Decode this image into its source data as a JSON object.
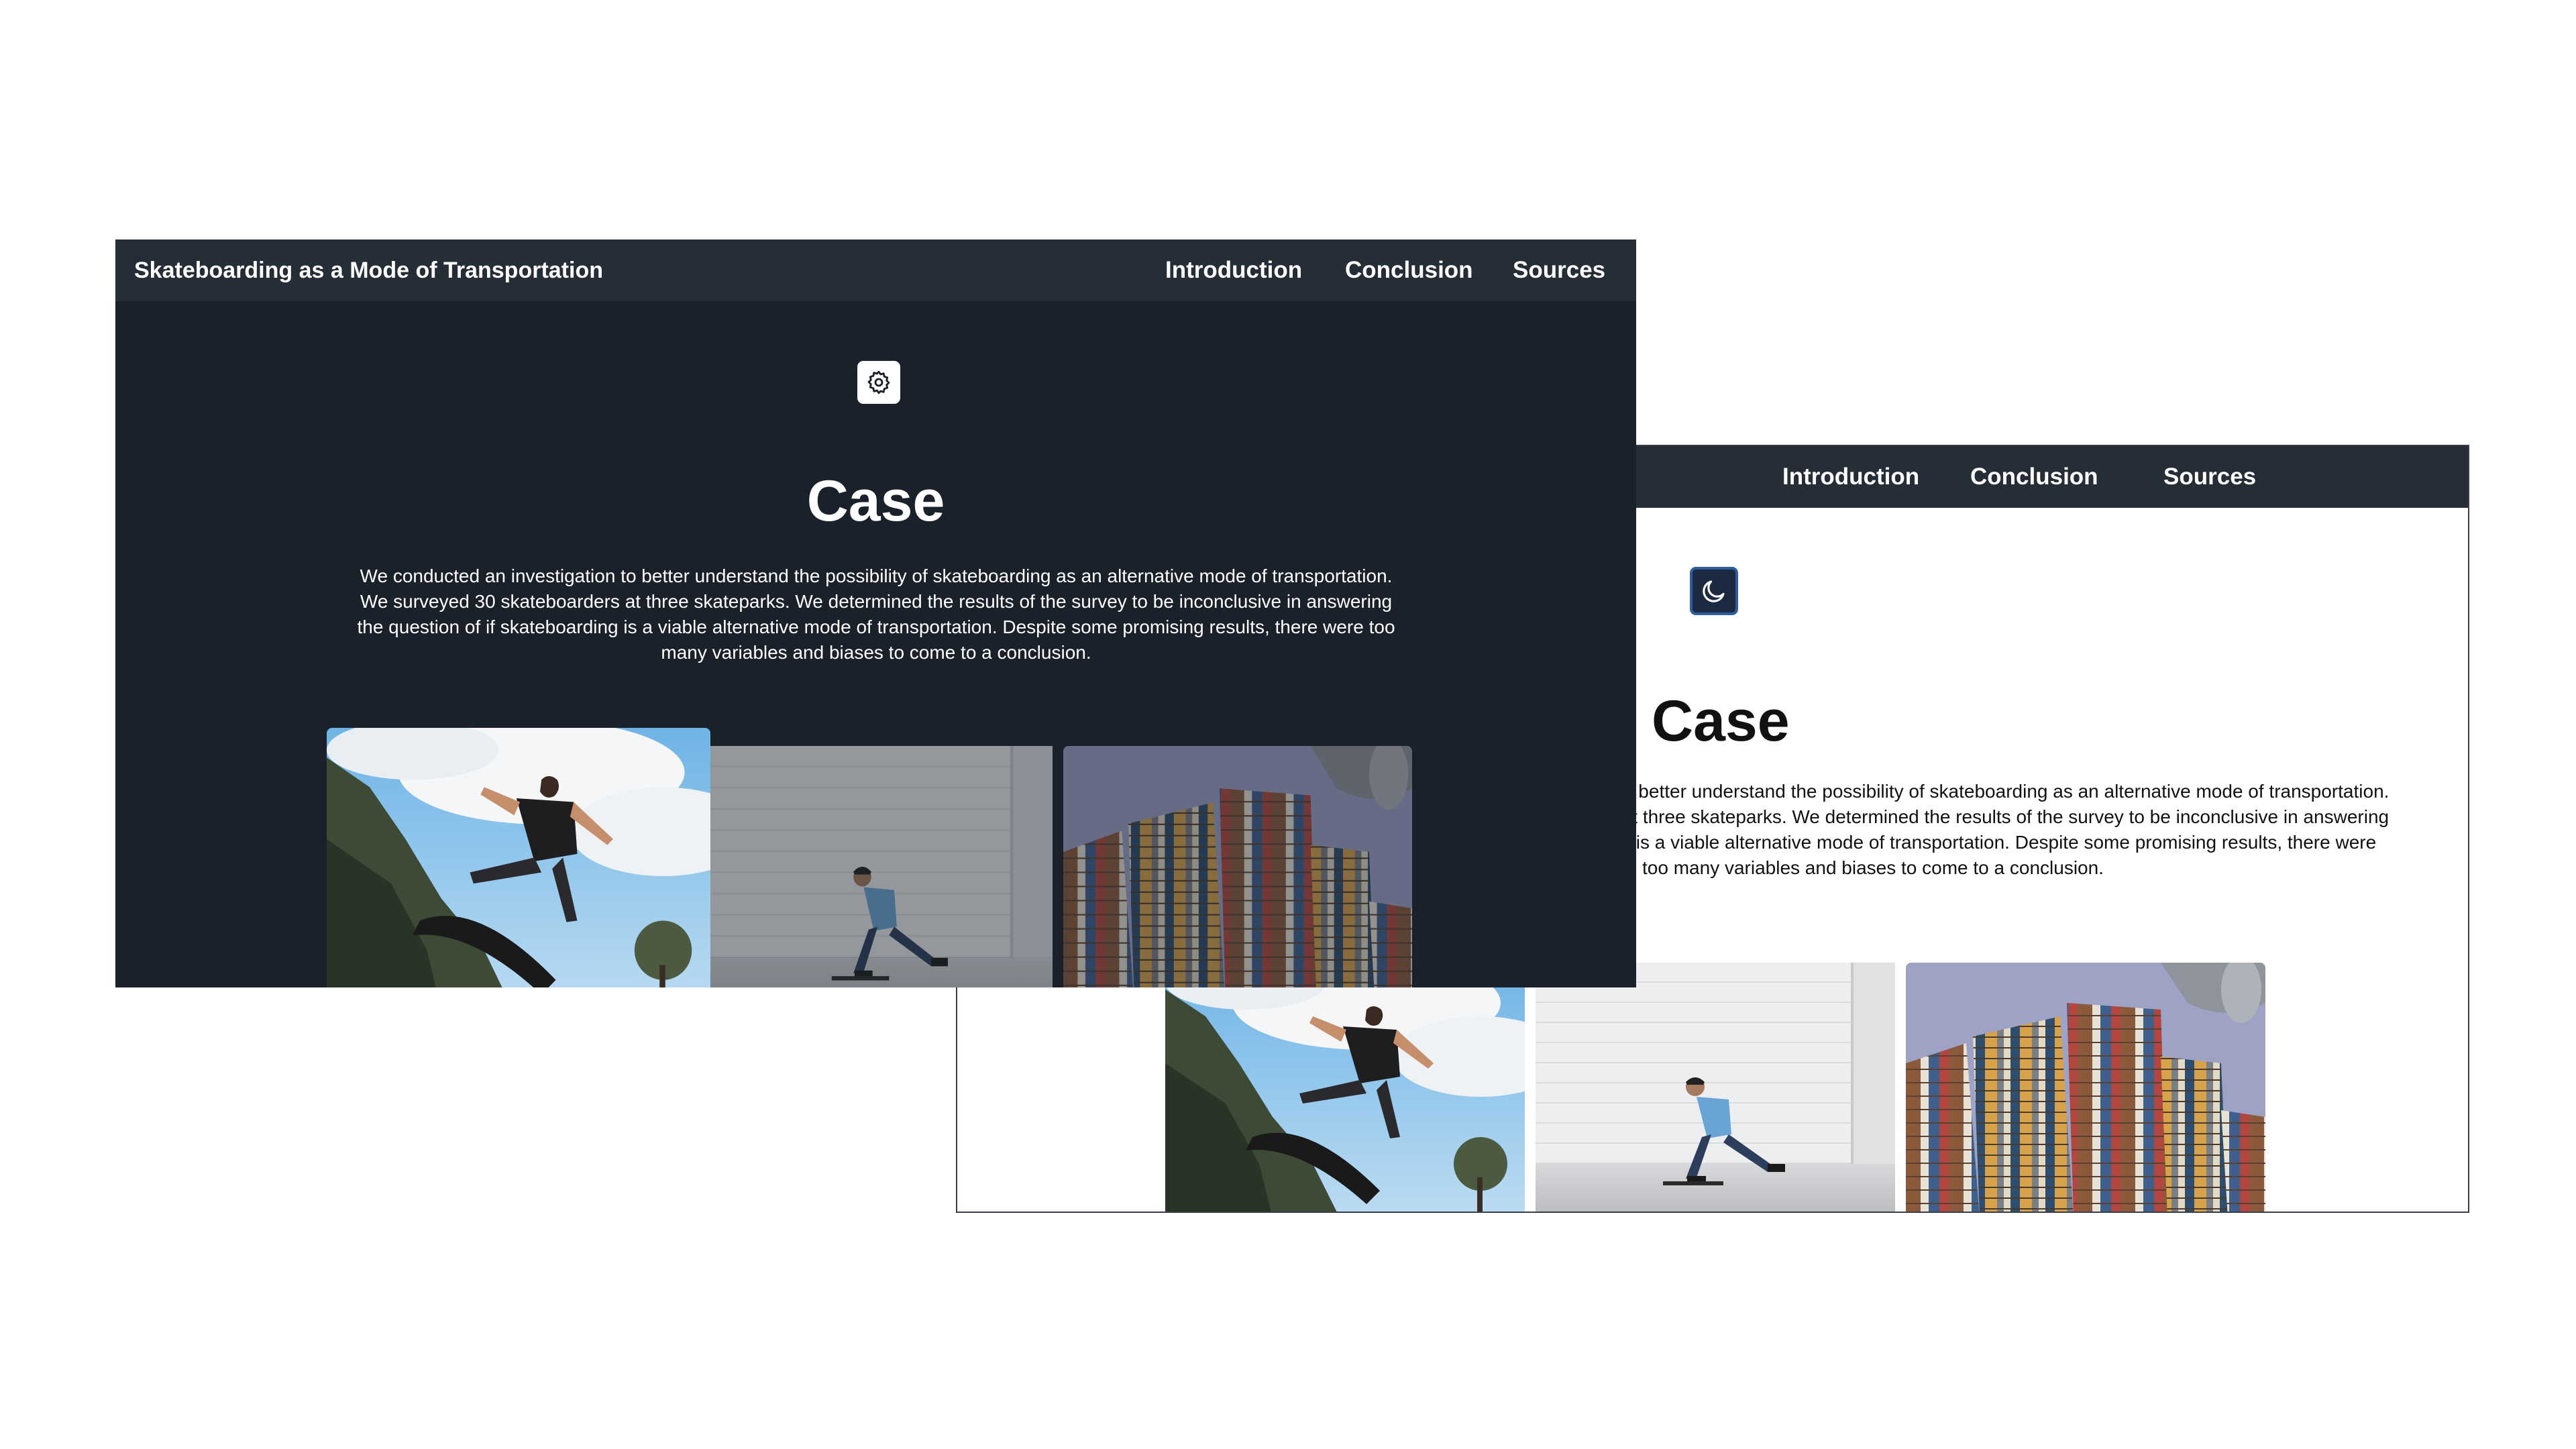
{
  "site": {
    "title": "Skateboarding as a Mode of Transportation",
    "nav": [
      "Introduction",
      "Conclusion",
      "Sources"
    ]
  },
  "main": {
    "heading": "Case",
    "paragraph": "We conducted an investigation to better understand the possibility of skateboarding as an alternative mode of transportation. We surveyed 30 skateboarders at three skateparks. We determined the results of the survey to be inconclusive in answering the question of if skateboarding is a viable alternative mode of transportation. Despite some promising results, there were too many variables and biases to come to a conclusion."
  },
  "theme_toggles": {
    "dark_mode_icon": "gear-icon",
    "light_mode_icon": "moon-icon"
  },
  "photos": [
    "skateboard-jump-photo",
    "skater-pushing-photo",
    "stacked-books-photo"
  ],
  "colors": {
    "navbar": "#252d37",
    "dark_background": "#1b212b",
    "light_background": "#ffffff",
    "moon_button": "#1b2a40",
    "moon_button_border": "#2e5c9e"
  }
}
